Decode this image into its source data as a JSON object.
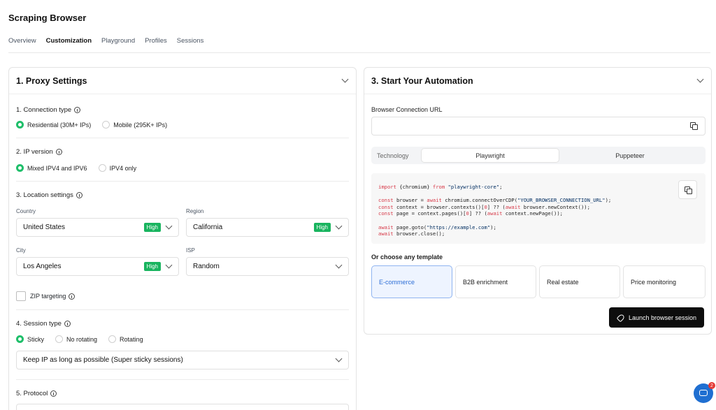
{
  "app": {
    "title": "Scraping Browser"
  },
  "tabs": [
    {
      "label": "Overview"
    },
    {
      "label": "Customization"
    },
    {
      "label": "Playground"
    },
    {
      "label": "Profiles"
    },
    {
      "label": "Sessions"
    }
  ],
  "proxy": {
    "title": "1. Proxy Settings",
    "connection_type": {
      "title": "1. Connection type",
      "options": [
        "Residential (30M+ IPs)",
        "Mobile (295K+ IPs)"
      ],
      "selected": "Residential (30M+ IPs)"
    },
    "ip_version": {
      "title": "2. IP version",
      "options": [
        "Mixed IPV4 and IPV6",
        "IPV4 only"
      ],
      "selected": "Mixed IPV4 and IPV6"
    },
    "location": {
      "title": "3. Location settings",
      "country_label": "Country",
      "country_value": "United States",
      "country_badge": "High",
      "region_label": "Region",
      "region_value": "California",
      "region_badge": "High",
      "city_label": "City",
      "city_value": "Los Angeles",
      "city_badge": "High",
      "isp_label": "ISP",
      "isp_value": "Random",
      "zip_label": "ZIP targeting"
    },
    "session_type": {
      "title": "4. Session type",
      "options": [
        "Sticky",
        "No rotating",
        "Rotating"
      ],
      "selected": "Sticky",
      "select_value": "Keep IP as long as possible (Super sticky sessions)"
    },
    "protocol": {
      "title": "5. Protocol"
    }
  },
  "automation": {
    "title": "3. Start Your Automation",
    "url_label": "Browser Connection URL",
    "url_value": "",
    "technology_label": "Technology",
    "technologies": [
      "Playwright",
      "Puppeteer"
    ],
    "technology_selected": "Playwright",
    "code": {
      "l1_kw": "import",
      "l1_mid": " {chromium} ",
      "l1_kw2": "from",
      "l1_str": " \"playwright-core\"",
      "l1_end": ";",
      "l2_kw": "const",
      "l2_mid": " browser = ",
      "l2_kw2": "await",
      "l2_mid2": " chromium.connectOverCDP(",
      "l2_str": "\"YOUR_BROWSER_CONNECTION_URL\"",
      "l2_end": ");",
      "l3_kw": "const",
      "l3_mid": " context = browser.contexts()[",
      "l3_num": "0",
      "l3_mid2": "] ?? (",
      "l3_kw2": "await",
      "l3_end": " browser.newContext());",
      "l4_kw": "const",
      "l4_mid": " page = context.pages()[",
      "l4_num": "0",
      "l4_mid2": "] ?? (",
      "l4_kw2": "await",
      "l4_end": " context.newPage());",
      "l5_kw": "await",
      "l5_mid": " page.goto(",
      "l5_str": "\"https://example.com\"",
      "l5_end": ");",
      "l6_kw": "await",
      "l6_end": " browser.close();"
    },
    "templates_label": "Or choose any template",
    "templates": [
      "E-commerce",
      "B2B enrichment",
      "Real estate",
      "Price monitoring"
    ],
    "template_selected": "E-commerce",
    "launch_label": "Launch browser session"
  },
  "chat": {
    "badge_count": "2"
  },
  "colors": {
    "accent_green": "#19b45f",
    "selected_blue": "#2f6fd6",
    "dark_button": "#0d0d0d",
    "chat_blue": "#1f6fd1"
  }
}
